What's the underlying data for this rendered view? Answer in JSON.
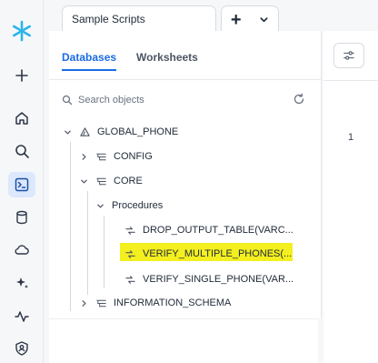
{
  "rail": {
    "icons": [
      "snowflake-logo-icon",
      "plus-icon",
      "home-icon",
      "search-icon",
      "worksheet-icon",
      "database-icon",
      "cloud-icon",
      "sparkle-icon",
      "activity-icon",
      "shield-user-icon"
    ],
    "active": "worksheet-icon"
  },
  "tabs": {
    "title": "Sample Scripts",
    "add_label": "+"
  },
  "panel": {
    "tabs": [
      {
        "label": "Databases",
        "active": true
      },
      {
        "label": "Worksheets",
        "active": false
      }
    ],
    "search_placeholder": "Search objects"
  },
  "tree": {
    "database": "GLOBAL_PHONE",
    "schemas": {
      "config": "CONFIG",
      "core": "CORE",
      "information_schema": "INFORMATION_SCHEMA"
    },
    "procedures_label": "Procedures",
    "procedures": [
      {
        "label": "DROP_OUTPUT_TABLE(VARC...",
        "highlighted": false
      },
      {
        "label": "VERIFY_MULTIPLE_PHONES(...",
        "highlighted": true
      },
      {
        "label": "VERIFY_SINGLE_PHONE(VAR...",
        "highlighted": false
      }
    ]
  },
  "editor": {
    "line_number": "1"
  },
  "colors": {
    "accent": "#1a6ce7",
    "logo": "#29b5e8",
    "highlight": "#f4ef1f"
  }
}
